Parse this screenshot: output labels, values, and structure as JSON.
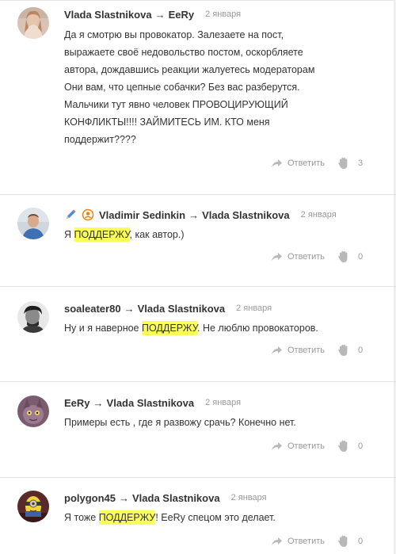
{
  "comments": [
    {
      "author": "Vlada Slastnikova",
      "recipient": "EeRy",
      "date": "2 января",
      "lines": [
        "Да я смотрю вы провокатор. Залезаете на пост,",
        "выражаете своё недовольство постом, оскорбляете",
        "автора, дождавшись реакции жалуетесь модераторам",
        "Они вам, что цепные собачки? Без вас разберутся.",
        "Мальчики тут явно человек ПРОВОЦИРУЮЩИЙ",
        "КОНФЛИКТЫ!!!! ЗАЙМИТЕСЬ ИМ. КТО меня",
        "поддержит????"
      ],
      "reply_label": "Ответить",
      "likes": "3"
    },
    {
      "author": "Vladimir Sedinkin",
      "recipient": "Vlada Slastnikova",
      "date": "2 января",
      "text_before": "Я ",
      "highlight": "ПОДДЕРЖУ",
      "text_after": ", как автор.)",
      "reply_label": "Ответить",
      "likes": "0"
    },
    {
      "author": "soaleater80",
      "recipient": "Vlada Slastnikova",
      "date": "2 января",
      "text_before": "Ну и я наверное ",
      "highlight": "ПОДДЕРЖУ",
      "text_after": ". Не люблю провокаторов.",
      "reply_label": "Ответить",
      "likes": "0"
    },
    {
      "author": "EeRy",
      "recipient": "Vlada Slastnikova",
      "date": "2 января",
      "text": "Примеры есть , где я развожу срачь? Конечно нет.",
      "reply_label": "Ответить",
      "likes": "0"
    },
    {
      "author": "polygon45",
      "recipient": "Vlada Slastnikova",
      "date": "2 января",
      "text_before": "Я тоже ",
      "highlight": "ПОДДЕРЖУ",
      "text_after": "! EeRy спецом это делает.",
      "reply_label": "Ответить",
      "likes": "0"
    }
  ],
  "arrow_glyph": "→",
  "icons": {
    "reply": "reply-arrow-icon",
    "like": "klass-hand-icon",
    "edit": "pencil-icon",
    "org": "org-badge-icon"
  },
  "colors": {
    "highlight": "#fbff5a",
    "muted": "#999999",
    "text": "#333333",
    "accent": "#ee8208"
  }
}
